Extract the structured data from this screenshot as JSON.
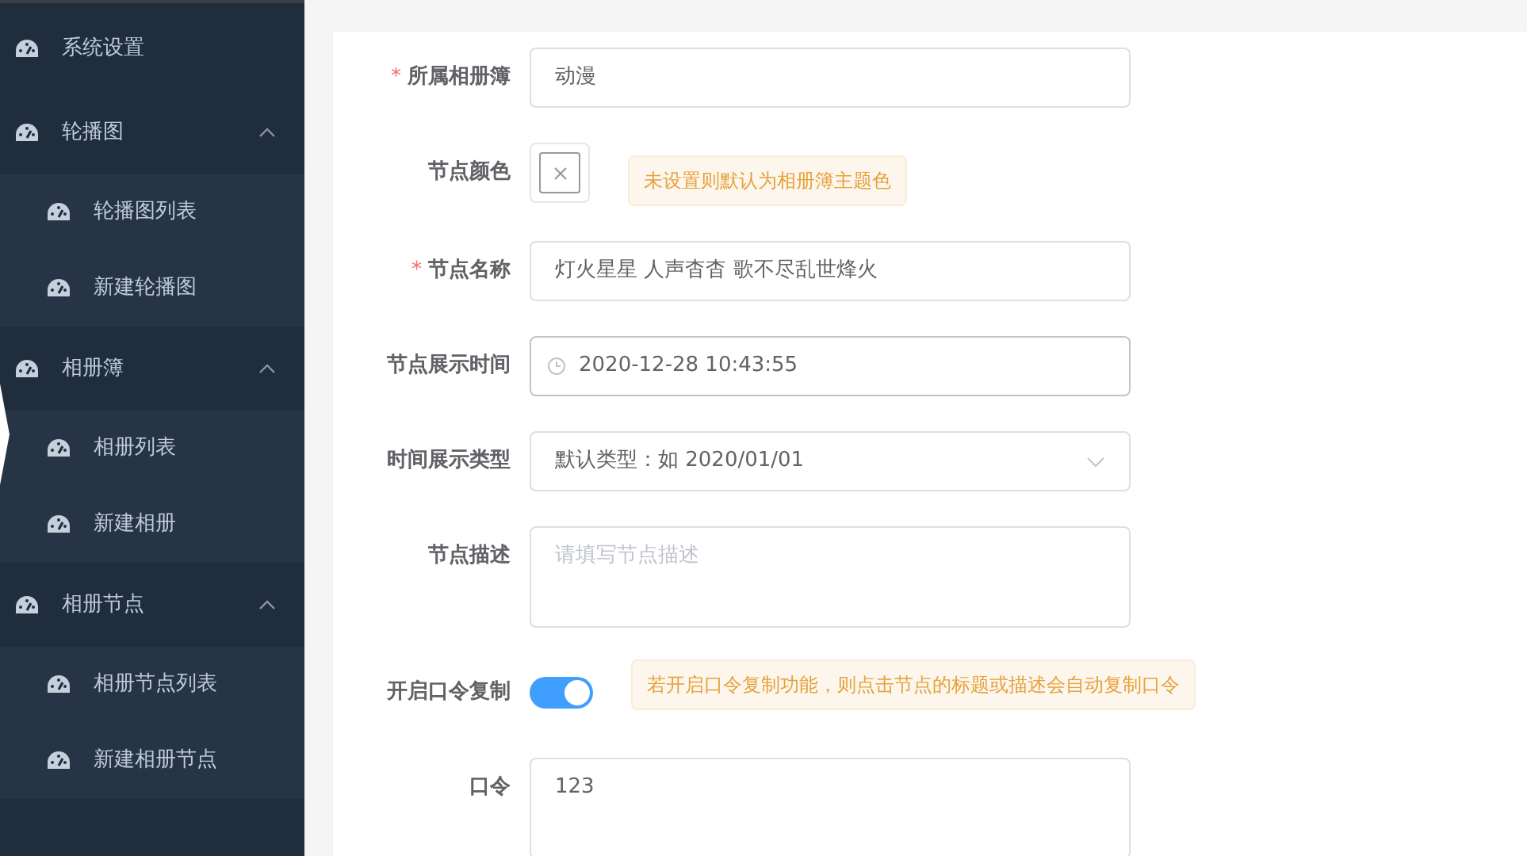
{
  "sidebar": {
    "items": [
      {
        "label": "系统设置"
      },
      {
        "label": "轮播图",
        "expanded": true,
        "children": [
          {
            "label": "轮播图列表"
          },
          {
            "label": "新建轮播图"
          }
        ]
      },
      {
        "label": "相册簿",
        "expanded": true,
        "children": [
          {
            "label": "相册列表"
          },
          {
            "label": "新建相册"
          }
        ]
      },
      {
        "label": "相册节点",
        "expanded": true,
        "children": [
          {
            "label": "相册节点列表"
          },
          {
            "label": "新建相册节点"
          }
        ]
      }
    ]
  },
  "form": {
    "fields": [
      {
        "kind": "input",
        "required_mark": "*",
        "label": "所属相册簿",
        "value": "动漫"
      },
      {
        "kind": "color",
        "label": "节点颜色",
        "hint": "未设置则默认为相册簿主题色"
      },
      {
        "kind": "input",
        "required_mark": "*",
        "label": "节点名称",
        "value": "灯火星星 人声杳杳 歌不尽乱世烽火"
      },
      {
        "kind": "datetime",
        "label": "节点展示时间",
        "value": "2020-12-28 10:43:55"
      },
      {
        "kind": "select",
        "label": "时间展示类型",
        "value": "默认类型：如 2020/01/01"
      },
      {
        "kind": "textarea",
        "label": "节点描述",
        "placeholder": "请填写节点描述"
      },
      {
        "kind": "switch",
        "label": "开启口令复制",
        "on": true,
        "hint": "若开启口令复制功能，则点击节点的标题或描述会自动复制口令"
      },
      {
        "kind": "textarea",
        "label": "口令",
        "value": "123"
      }
    ]
  }
}
